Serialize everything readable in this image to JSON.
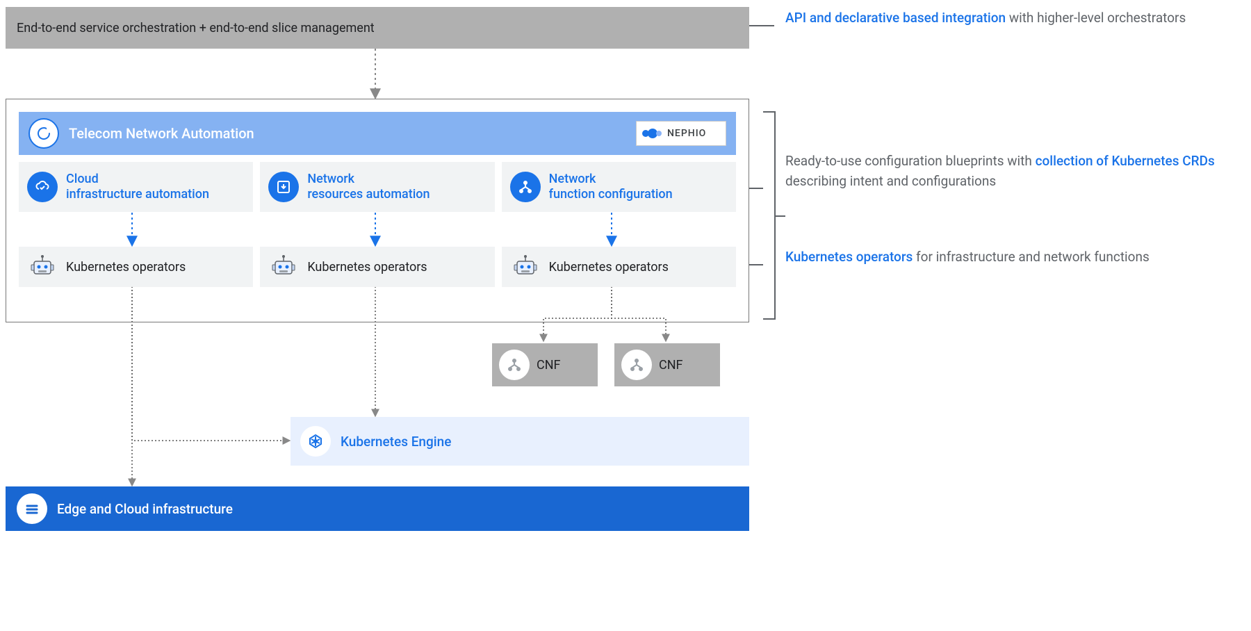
{
  "top": {
    "label": "End-to-end service orchestration + end-to-end slice management"
  },
  "tna": {
    "title": "Telecom Network Automation",
    "nephio_label": "NEPHIO",
    "pillars": [
      {
        "line1": "Cloud",
        "line2": "infrastructure automation"
      },
      {
        "line1": "Network",
        "line2": "resources automation"
      },
      {
        "line1": "Network",
        "line2": "function configuration"
      }
    ],
    "operators_label": "Kubernetes operators"
  },
  "cnf": {
    "label": "CNF"
  },
  "k8s_engine": {
    "label": "Kubernetes Engine"
  },
  "edge": {
    "label": "Edge and Cloud infrastructure"
  },
  "annotations": {
    "a1_blue": "API and declarative based integration",
    "a1_rest": " with higher-level orchestrators",
    "a2_pre": "Ready-to-use configuration blueprints with ",
    "a2_blue": "collection of Kubernetes CRDs",
    "a2_post": " describing intent and configurations",
    "a3_blue": "Kubernetes operators",
    "a3_rest": " for infrastructure and network functions"
  },
  "colors": {
    "accent_blue": "#1a73e8",
    "header_blue": "#85b2f2",
    "light_blue_bg": "#e8f0fe",
    "gray_box": "#b0b0b0",
    "text_gray": "#5f6368",
    "edge_blue": "#1967d2"
  }
}
